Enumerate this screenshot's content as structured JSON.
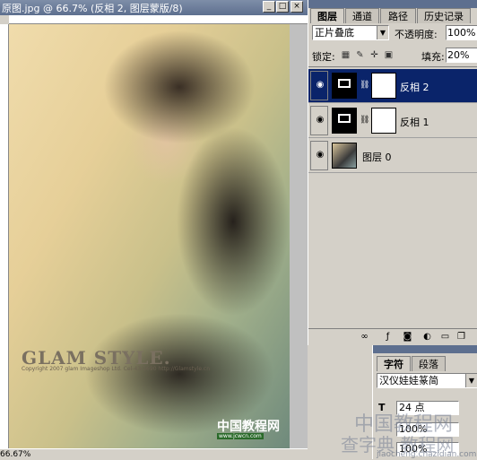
{
  "document": {
    "title": "原图.jpg @ 66.7% (反相 2, 图层蒙版/8)",
    "zoom": "66.67%",
    "image_text": {
      "logo": "GLAM STYLE.",
      "logo_sub": "Copyright 2007 glam Imageshop Ltd. Cel-43-5690 http://Glamstyle.cn",
      "watermark": "中国教程网",
      "watermark_url": "www.jcwcn.com"
    },
    "buttons": {
      "minimize": "_",
      "maximize": "□",
      "close": "×"
    }
  },
  "layers_panel": {
    "tabs": [
      {
        "label": "图层",
        "active": true
      },
      {
        "label": "通道",
        "active": false
      },
      {
        "label": "路径",
        "active": false
      },
      {
        "label": "历史记录",
        "active": false
      }
    ],
    "blend_mode": "正片叠底",
    "opacity_label": "不透明度:",
    "opacity_value": "100%",
    "lock_label": "锁定:",
    "fill_label": "填充:",
    "fill_value": "20%",
    "layers": [
      {
        "name": "反相 2",
        "selected": true
      },
      {
        "name": "反相 1",
        "selected": false
      },
      {
        "name": "图层 0",
        "selected": false
      }
    ]
  },
  "character_panel": {
    "tabs": [
      {
        "label": "字符",
        "active": true
      },
      {
        "label": "段落",
        "active": false
      }
    ],
    "font": "汉仪娃娃篆简",
    "size": "24 点",
    "scale": "100%",
    "scale2": "100%"
  },
  "site_watermark": {
    "line1": "中国教程网",
    "line2": "查字典 教程网",
    "url": "jiaocheng.chazidian.com"
  }
}
